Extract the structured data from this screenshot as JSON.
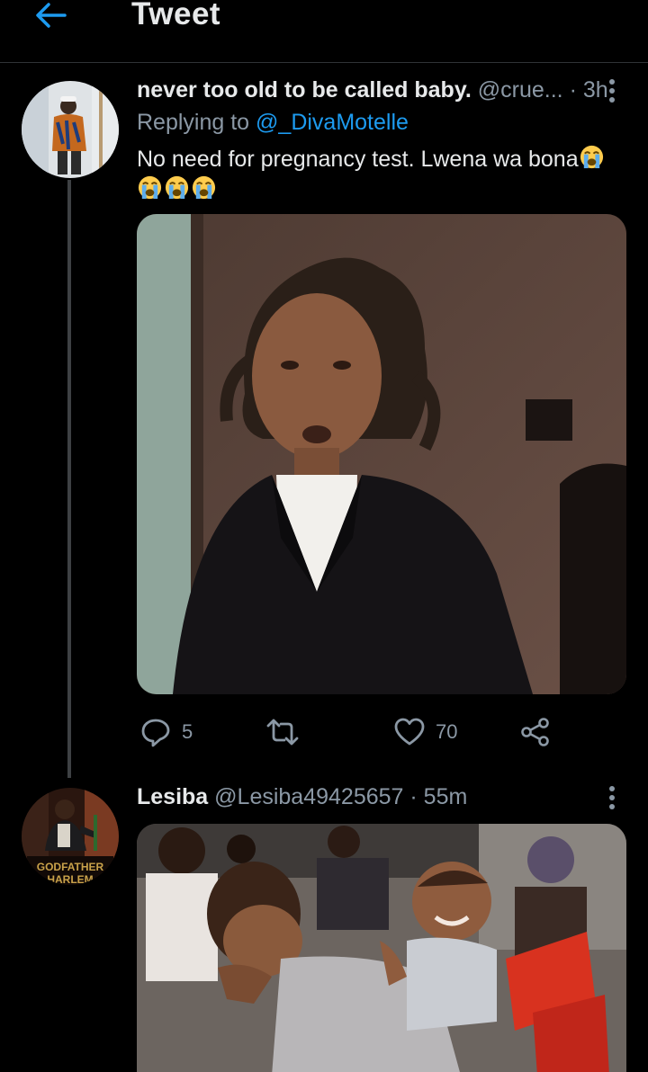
{
  "header": {
    "title": "Tweet",
    "back_icon": "arrow-left-icon"
  },
  "tweet": {
    "author_name": "never too old to be called baby.",
    "author_handle": "@crue...",
    "separator": "·",
    "time": "3h",
    "replying_prefix": "Replying to",
    "replying_to": "@_DivaMotelle",
    "text": "No need for pregnancy test. Lwena wa bona",
    "emoji": "loudly-crying-face",
    "emoji_count_inline": 1,
    "emoji_count_row": 3,
    "media_description": "photo",
    "actions": {
      "replies": "5",
      "retweets": "",
      "likes": "70"
    }
  },
  "reply": {
    "author_name": "Lesiba",
    "author_handle": "@Lesiba49425657",
    "separator": "·",
    "time": "55m",
    "avatar_caption": "GODFATHER",
    "avatar_caption2": "HARLEM"
  },
  "colors": {
    "background": "#000000",
    "accent": "#1d9bf0",
    "muted": "#8b98a5",
    "divider": "#2f3336"
  }
}
